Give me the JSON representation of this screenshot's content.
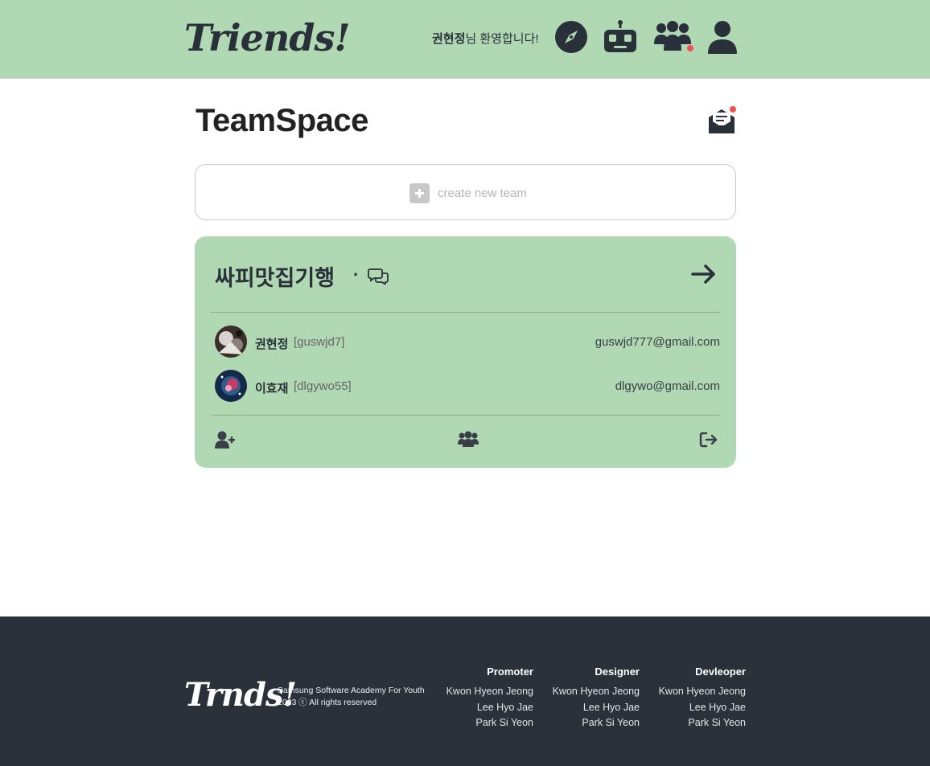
{
  "header": {
    "logo": "Triends!",
    "welcome_name": "권현정",
    "welcome_suffix": "님 환영합니다!",
    "icons": [
      "compass-icon",
      "robot-icon",
      "group-icon",
      "user-icon"
    ],
    "accent": "#b0d8b2",
    "notification_color": "#ef5350"
  },
  "main": {
    "title": "TeamSpace",
    "mail_icon": "envelope-open-icon",
    "create_team_label": "create new team"
  },
  "team_card": {
    "name": "싸피맛집기행",
    "separator": "·",
    "members": [
      {
        "name": "권현정",
        "id": "[guswjd7]",
        "email": "guswjd777@gmail.com"
      },
      {
        "name": "이효재",
        "id": "[dlgywo55]",
        "email": "dlgywo@gmail.com"
      }
    ],
    "footer_icons": [
      "user-plus-icon",
      "users-icon",
      "sign-out-icon"
    ]
  },
  "footer": {
    "logo": "Trnds!",
    "line1": "Samsung Software Academy For Youth",
    "line2": "2023 ⓒ All rights reserved",
    "columns": [
      {
        "heading": "Promoter",
        "names": [
          "Kwon Hyeon Jeong",
          "Lee Hyo Jae",
          "Park Si Yeon"
        ]
      },
      {
        "heading": "Designer",
        "names": [
          "Kwon Hyeon Jeong",
          "Lee Hyo Jae",
          "Park Si Yeon"
        ]
      },
      {
        "heading": "Devleoper",
        "names": [
          "Kwon Hyeon Jeong",
          "Lee Hyo Jae",
          "Park Si Yeon"
        ]
      }
    ],
    "background": "#2a313b"
  }
}
